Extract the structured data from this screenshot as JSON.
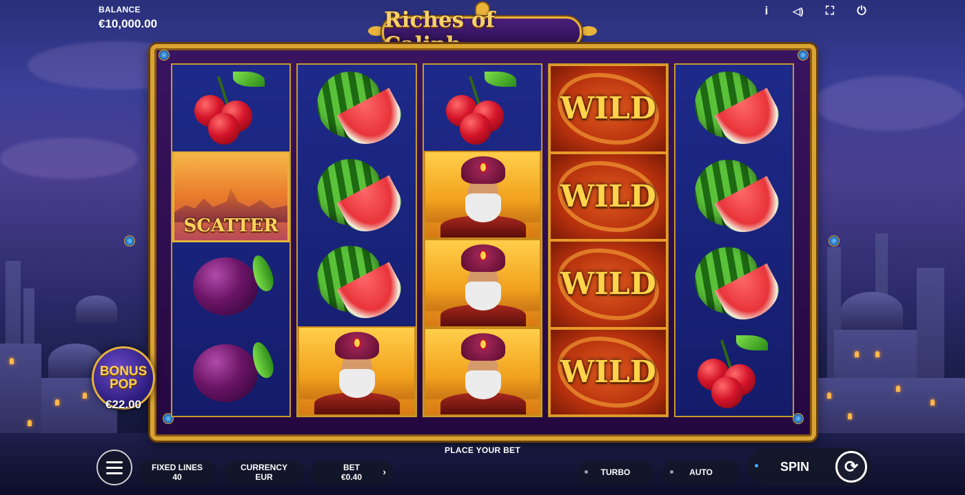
{
  "header": {
    "balance_label": "BALANCE",
    "balance_value": "€10,000.00",
    "title": "Riches of Caliph",
    "icons": [
      {
        "name": "info-icon",
        "glyph": "i"
      },
      {
        "name": "sound-icon",
        "glyph": "◁)"
      },
      {
        "name": "fullscreen-icon",
        "glyph": "⛶"
      },
      {
        "name": "power-icon",
        "glyph": "⏻"
      }
    ]
  },
  "reels": [
    [
      "cherry",
      "scatter",
      "plum",
      "plum"
    ],
    [
      "watermelon",
      "watermelon",
      "watermelon",
      "caliph"
    ],
    [
      "cherry",
      "caliph",
      "caliph",
      "caliph"
    ],
    [
      "wild",
      "wild",
      "wild",
      "wild"
    ],
    [
      "watermelon",
      "watermelon",
      "watermelon",
      "cherry"
    ]
  ],
  "symbols": {
    "scatter_label": "SCATTER",
    "wild_label": "WILD"
  },
  "bonus_pop": {
    "title_line1": "BONUS",
    "title_line2": "POP",
    "value": "€22.00"
  },
  "controls": {
    "place_bet": "PLACE YOUR BET",
    "fixed_lines_label": "FIXED LINES",
    "fixed_lines_value": "40",
    "currency_label": "CURRENCY",
    "currency_value": "EUR",
    "bet_label": "BET",
    "bet_value": "€0.40",
    "turbo_label": "TURBO",
    "auto_label": "AUTO",
    "spin_label": "SPIN"
  },
  "colors": {
    "gold": "#d9a431",
    "frame_purple": "#3a1460",
    "reel_blue": "#1e2a8a",
    "spin_indicator": "#3ab0ff"
  }
}
